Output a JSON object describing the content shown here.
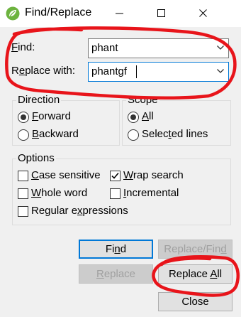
{
  "window": {
    "title": "Find/Replace",
    "icon": "spring-leaf-icon",
    "minimize_icon": "minimize-icon",
    "maximize_icon": "maximize-icon",
    "close_icon": "close-icon"
  },
  "find": {
    "label_u": "F",
    "label_rest": "ind:",
    "value": "phant"
  },
  "replace": {
    "label_pre": "R",
    "label_u": "e",
    "label_rest": "place with:",
    "value": "phantgf"
  },
  "direction": {
    "title": "Direction",
    "forward": {
      "u": "F",
      "rest": "orward",
      "checked": true
    },
    "backward": {
      "u": "B",
      "rest": "ackward",
      "checked": false
    }
  },
  "scope": {
    "title": "Scope",
    "all": {
      "u": "A",
      "rest": "ll",
      "checked": true
    },
    "selected": {
      "pre": "Selec",
      "u": "t",
      "rest": "ed lines",
      "checked": false
    }
  },
  "options": {
    "title": "Options",
    "case_sensitive": {
      "u": "C",
      "rest": "ase sensitive",
      "checked": false
    },
    "wrap_search": {
      "u": "W",
      "rest": "rap search",
      "checked": true
    },
    "whole_word": {
      "u": "W",
      "rest": "hole word",
      "checked": false
    },
    "incremental": {
      "u": "I",
      "rest": "ncremental",
      "checked": false
    },
    "regex": {
      "pre": "Regular e",
      "u": "x",
      "rest": "pressions",
      "checked": false
    }
  },
  "buttons": {
    "find": {
      "pre": "Fi",
      "u": "n",
      "rest": "d"
    },
    "replace_find": {
      "pre": "Replace/Fin",
      "u": "d",
      "rest": ""
    },
    "replace": {
      "pre": "",
      "u": "R",
      "rest": "eplace"
    },
    "replace_all": {
      "pre": "Replace ",
      "u": "A",
      "rest": "ll"
    },
    "close": "Close"
  },
  "annotation_color": "#e8141a"
}
